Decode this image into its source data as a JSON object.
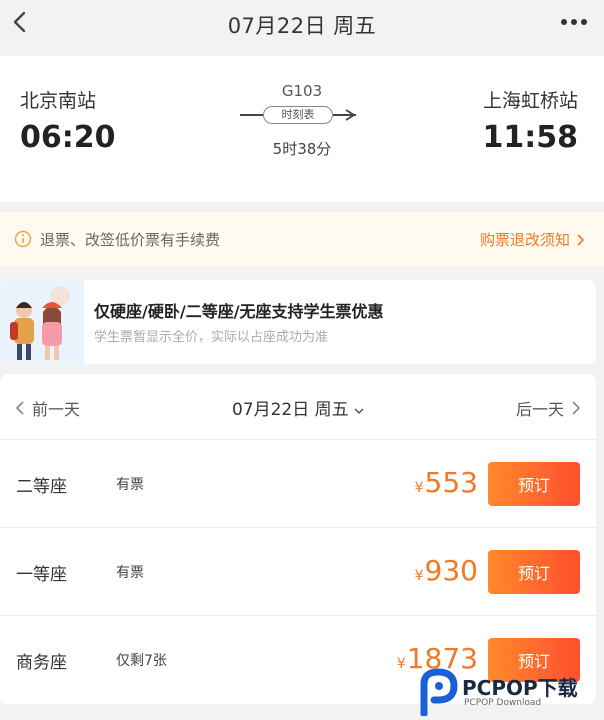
{
  "header": {
    "title": "07月22日 周五",
    "back_icon": "chevron-left-icon",
    "more_icon": "more-dots-icon"
  },
  "train": {
    "from_station": "北京南站",
    "to_station": "上海虹桥站",
    "departure_time": "06:20",
    "arrival_time": "11:58",
    "train_number": "G103",
    "schedule_label": "时刻表",
    "duration": "5时38分"
  },
  "notice": {
    "icon": "info-circle-icon",
    "text": "退票、改签低价票有手续费",
    "link_label": "购票退改须知"
  },
  "student": {
    "title": "仅硬座/硬卧/二等座/无座支持学生票优惠",
    "subtitle": "学生票暂显示全价，实际以占座成功为准"
  },
  "date_nav": {
    "prev_label": "前一天",
    "current_date": "07月22日 周五",
    "next_label": "后一天"
  },
  "seats": [
    {
      "name": "二等座",
      "availability": "有票",
      "currency": "¥",
      "price": "553",
      "book_label": "预订"
    },
    {
      "name": "一等座",
      "availability": "有票",
      "currency": "¥",
      "price": "930",
      "book_label": "预订"
    },
    {
      "name": "商务座",
      "availability": "仅剩7张",
      "currency": "¥",
      "price": "1873",
      "book_label": "预订"
    }
  ],
  "watermark": {
    "title": "PCPOP下载",
    "subtitle": "PCPOP Download"
  },
  "colors": {
    "accent": "#f07a28",
    "button_gradient_start": "#ff8a2a",
    "button_gradient_end": "#ff4e2f",
    "background": "#f2f2f2"
  }
}
